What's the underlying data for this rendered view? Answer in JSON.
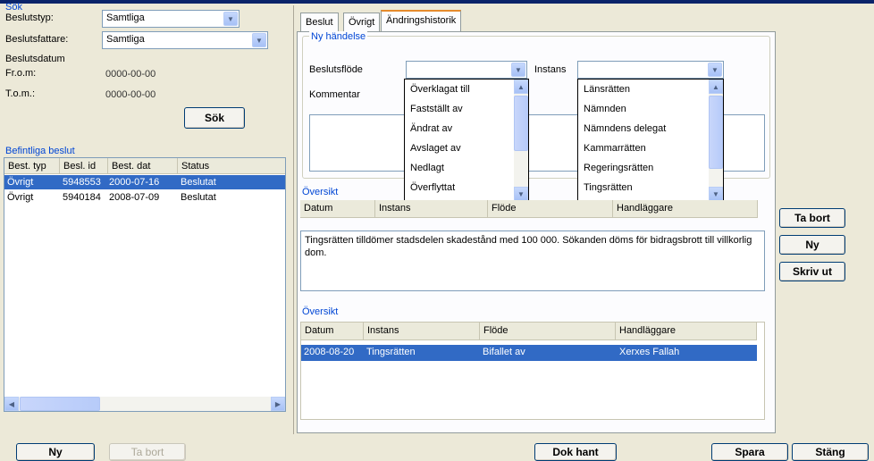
{
  "search": {
    "group_label": "Sök",
    "beslutstyp_label": "Beslutstyp:",
    "beslutstyp_value": "Samtliga",
    "beslutsfattare_label": "Beslutsfattare:",
    "beslutsfattare_value": "Samtliga",
    "beslutsdatum_label": "Beslutsdatum",
    "from_label": "Fr.o.m:",
    "from_value": "0000-00-00",
    "to_label": "T.o.m.:",
    "to_value": "0000-00-00",
    "sok_button": "Sök"
  },
  "existing": {
    "group_label": "Befintliga beslut",
    "columns": [
      "Best. typ",
      "Besl. id",
      "Best. dat",
      "Status"
    ],
    "rows": [
      {
        "typ": "Övrigt",
        "id": "5948553",
        "dat": "2000-07-16",
        "status": "Beslutat"
      },
      {
        "typ": "Övrigt",
        "id": "5940184",
        "dat": "2008-07-09",
        "status": "Beslutat"
      }
    ]
  },
  "tabs": [
    "Beslut",
    "Övrigt",
    "Ändringshistorik"
  ],
  "ny_handelse": {
    "group_label": "Ny händelse",
    "beslutsflode_label": "Beslutsflöde",
    "instans_label": "Instans",
    "kommentar_label": "Kommentar"
  },
  "beslutsflode_options": [
    "Överklagat till",
    "Fastställt av",
    "Ändrat av",
    "Avslaget av",
    "Nedlagt",
    "Överflyttat"
  ],
  "instans_options": [
    "Länsrätten",
    "Nämnden",
    "Nämndens delegat",
    "Kammarrätten",
    "Regeringsrätten",
    "Tingsrätten"
  ],
  "oversikt1": {
    "group_label": "Översikt",
    "columns": [
      "Datum",
      "Instans",
      "Flöde",
      "Handläggare"
    ],
    "text": "Tingsrätten tilldömer stadsdelen skadestånd med 100 000. Sökanden döms för bidragsbrott till villkorlig dom."
  },
  "oversikt2": {
    "group_label": "Översikt",
    "columns": [
      "Datum",
      "Instans",
      "Flöde",
      "Handläggare"
    ],
    "rows": [
      {
        "datum": "2008-08-20",
        "instans": "Tingsrätten",
        "flode": "Bifallet av",
        "handlaggare": "Xerxes Fallah"
      }
    ]
  },
  "side_buttons": {
    "ta_bort": "Ta bort",
    "ny": "Ny",
    "skriv_ut": "Skriv ut"
  },
  "bottom_buttons": {
    "ny": "Ny",
    "ta_bort": "Ta bort",
    "dok_hant": "Dok hant",
    "spara": "Spara",
    "stang": "Stäng"
  },
  "colors": {
    "selection": "#316ac5",
    "group_label": "#0046d5",
    "window_bg": "#ece9d8"
  }
}
